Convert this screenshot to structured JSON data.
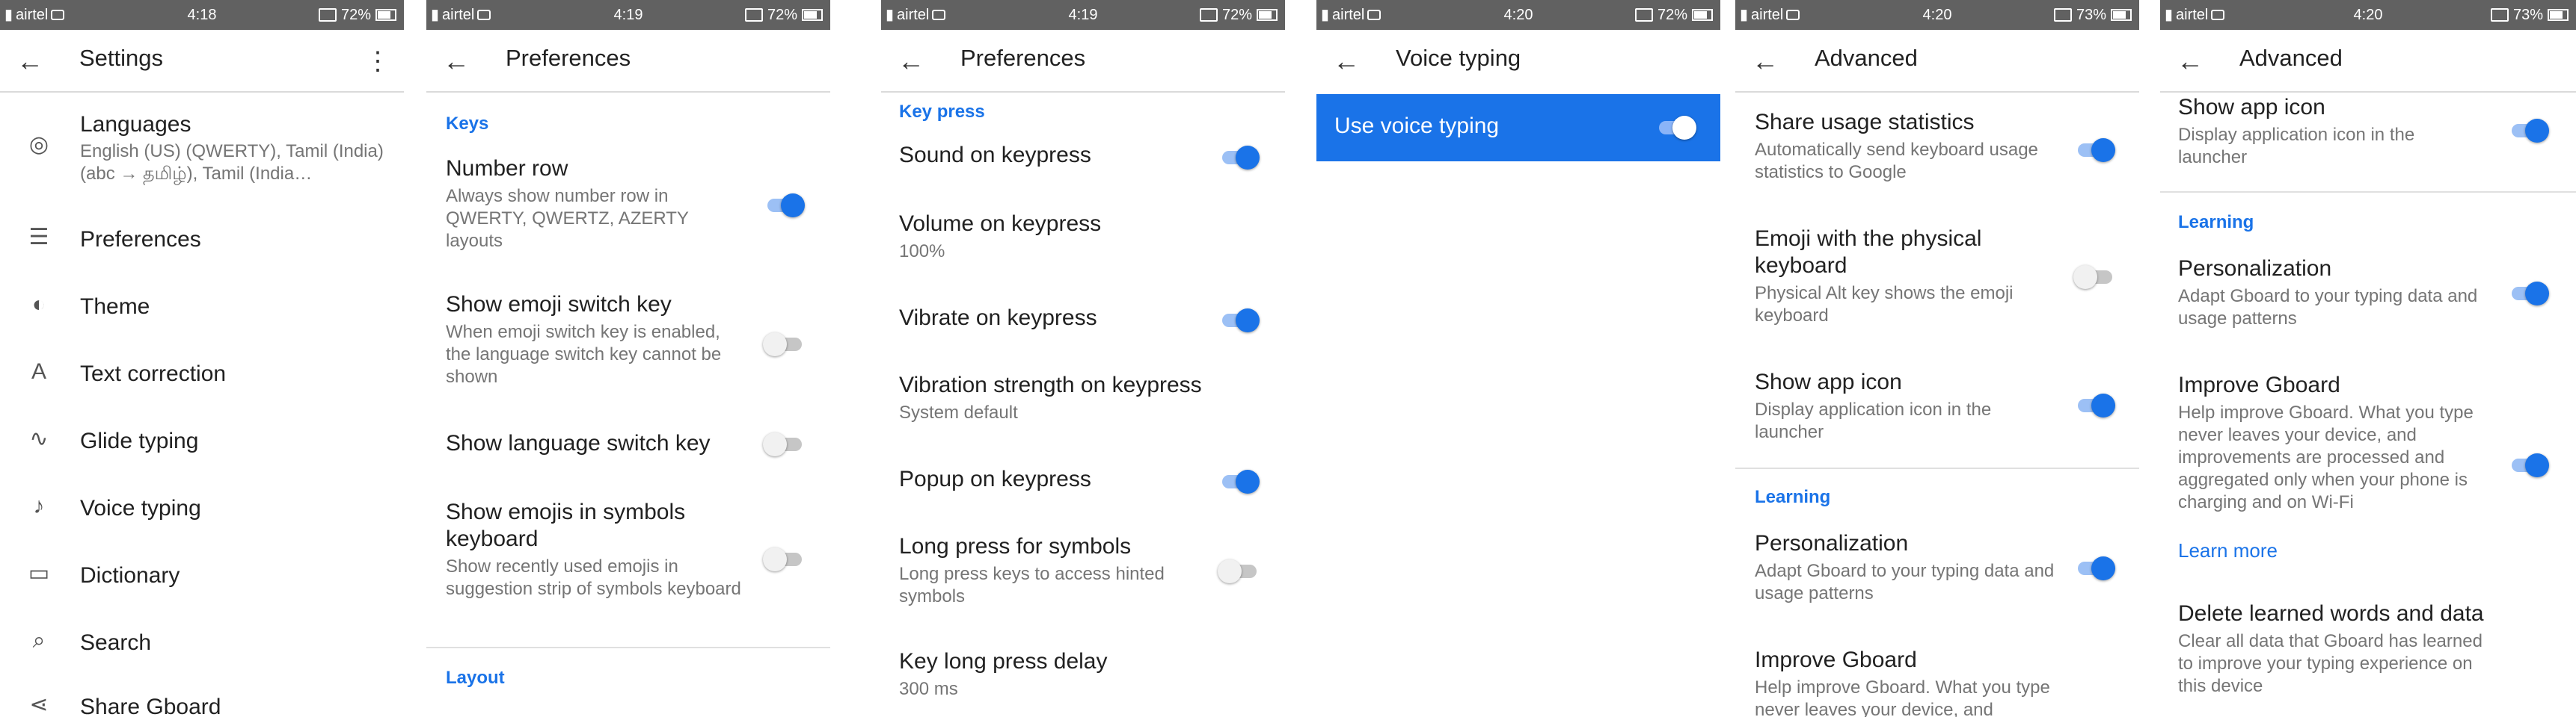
{
  "status": {
    "carrier": "airtel",
    "battery": [
      "72%",
      "72%",
      "72%",
      "72%",
      "73%",
      "73%"
    ],
    "time": [
      "4:18",
      "4:19",
      "4:19",
      "4:20",
      "4:20",
      "4:20"
    ]
  },
  "s1": {
    "title": "Settings",
    "items": [
      {
        "label": "Languages",
        "sub": "English (US) (QWERTY), Tamil (India) (abc → தமிழ்), Tamil (India…"
      },
      {
        "label": "Preferences"
      },
      {
        "label": "Theme"
      },
      {
        "label": "Text correction"
      },
      {
        "label": "Glide typing"
      },
      {
        "label": "Voice typing"
      },
      {
        "label": "Dictionary"
      },
      {
        "label": "Search"
      },
      {
        "label": "Share Gboard"
      }
    ]
  },
  "s2": {
    "title": "Preferences",
    "keys": "Keys",
    "layout": "Layout",
    "r1": {
      "t": "Number row",
      "s": "Always show number row in QWERTY, QWERTZ, AZERTY layouts"
    },
    "r2": {
      "t": "Show emoji switch key",
      "s": "When emoji switch key is enabled, the language switch key cannot be shown"
    },
    "r3": {
      "t": "Show language switch key"
    },
    "r4": {
      "t": "Show emojis in symbols keyboard",
      "s": "Show recently used emojis in suggestion strip of symbols keyboard"
    }
  },
  "s3": {
    "title": "Preferences",
    "keypress": "Key press",
    "r1": {
      "t": "Sound on keypress"
    },
    "r2": {
      "t": "Volume on keypress",
      "s": "100%"
    },
    "r3": {
      "t": "Vibrate on keypress"
    },
    "r4": {
      "t": "Vibration strength on keypress",
      "s": "System default"
    },
    "r5": {
      "t": "Popup on keypress"
    },
    "r6": {
      "t": "Long press for symbols",
      "s": "Long press keys to access hinted symbols"
    },
    "r7": {
      "t": "Key long press delay",
      "s": "300 ms"
    }
  },
  "s4": {
    "title": "Voice typing",
    "use": "Use voice typing"
  },
  "s5": {
    "title": "Advanced",
    "learning": "Learning",
    "r1": {
      "t": "Share usage statistics",
      "s": "Automatically send keyboard usage statistics to Google"
    },
    "r2": {
      "t": "Emoji with the physical keyboard",
      "s": "Physical Alt key shows the emoji keyboard"
    },
    "r3": {
      "t": "Show app icon",
      "s": "Display application icon in the launcher"
    },
    "r4": {
      "t": "Personalization",
      "s": "Adapt Gboard to your typing data and usage patterns"
    },
    "r5": {
      "t": "Improve Gboard",
      "s": "Help improve Gboard. What you type never leaves your device, and"
    }
  },
  "s6": {
    "title": "Advanced",
    "learning": "Learning",
    "learn_more": "Learn more",
    "r1": {
      "t": "Show app icon",
      "s": "Display application icon in the launcher"
    },
    "r2": {
      "t": "Personalization",
      "s": "Adapt Gboard to your typing data and usage patterns"
    },
    "r3": {
      "t": "Improve Gboard",
      "s": "Help improve Gboard. What you type never leaves your device, and improvements are processed and aggregated only when your phone is charging and on Wi-Fi"
    },
    "r4": {
      "t": "Delete learned words and data",
      "s": "Clear all data that Gboard has learned to improve your typing experience on this device"
    }
  }
}
